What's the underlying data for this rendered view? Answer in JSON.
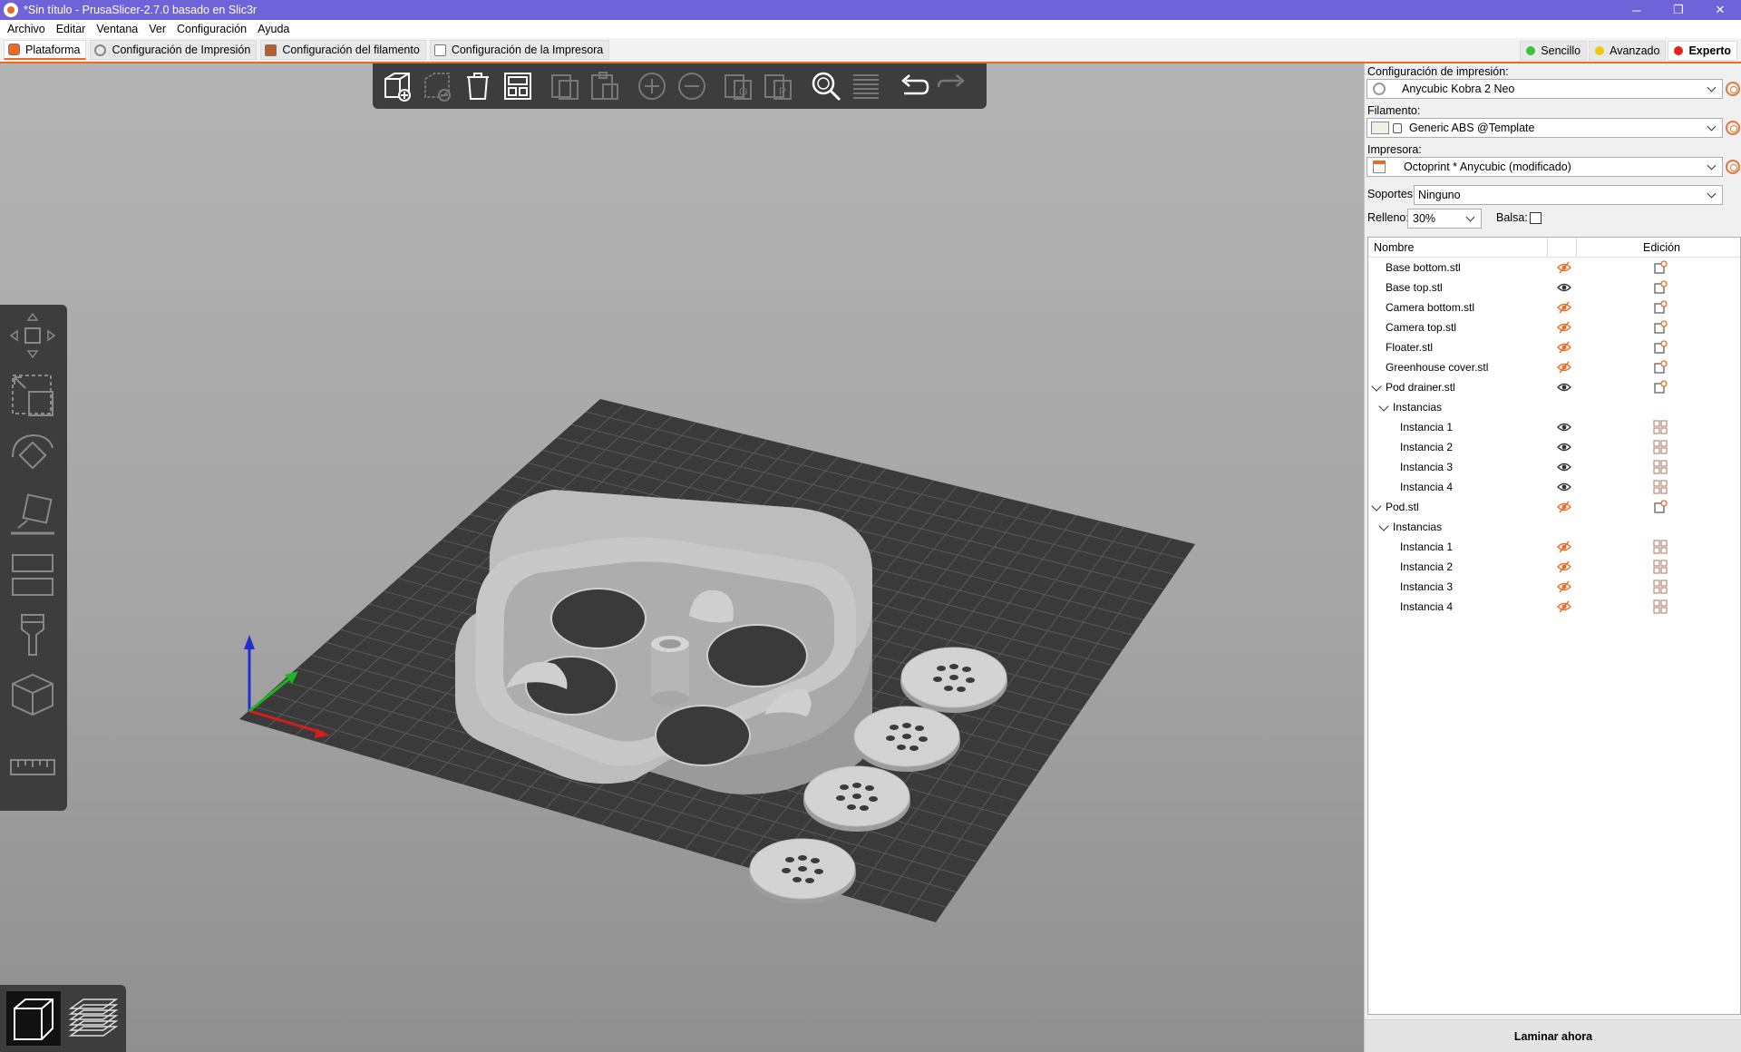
{
  "window": {
    "title": "*Sin título - PrusaSlicer-2.7.0 basado en Slic3r",
    "minimize": "─",
    "maximize": "❐",
    "close": "✕"
  },
  "menu": [
    "Archivo",
    "Editar",
    "Ventana",
    "Ver",
    "Configuración",
    "Ayuda"
  ],
  "tabs": [
    {
      "label": "Plataforma",
      "icon": "plater-icon",
      "active": true
    },
    {
      "label": "Configuración de Impresión",
      "icon": "print-settings-icon",
      "active": false
    },
    {
      "label": "Configuración del filamento",
      "icon": "filament-spool-icon",
      "active": false
    },
    {
      "label": "Configuración de la Impresora",
      "icon": "printer-icon",
      "active": false
    }
  ],
  "modes": [
    {
      "label": "Sencillo",
      "color": "#3cc03c",
      "active": false
    },
    {
      "label": "Avanzado",
      "color": "#f0c814",
      "active": false
    },
    {
      "label": "Experto",
      "color": "#e02222",
      "active": true
    }
  ],
  "sidebar": {
    "print_label": "Configuración de impresión:",
    "print_value": "Anycubic Kobra 2 Neo",
    "filament_label": "Filamento:",
    "filament_value": "Generic ABS @Template",
    "printer_label": "Impresora:",
    "printer_value": "Octoprint * Anycubic (modificado)",
    "supports_label": "Soportes:",
    "supports_value": "Ninguno",
    "infill_label": "Relleno:",
    "infill_value": "30%",
    "brim_label": "Balsa:",
    "brim_checked": false,
    "col_name": "Nombre",
    "col_edit": "Edición",
    "slice_button": "Laminar ahora"
  },
  "objects": [
    {
      "label": "Base bottom.stl",
      "level": 0,
      "visible": false,
      "expanded": null,
      "edit": "object-edit-icon"
    },
    {
      "label": "Base top.stl",
      "level": 0,
      "visible": true,
      "expanded": null,
      "edit": "object-edit-icon"
    },
    {
      "label": "Camera bottom.stl",
      "level": 0,
      "visible": false,
      "expanded": null,
      "edit": "object-edit-icon"
    },
    {
      "label": "Camera top.stl",
      "level": 0,
      "visible": false,
      "expanded": null,
      "edit": "object-edit-icon"
    },
    {
      "label": "Floater.stl",
      "level": 0,
      "visible": false,
      "expanded": null,
      "edit": "object-edit-icon"
    },
    {
      "label": "Greenhouse cover.stl",
      "level": 0,
      "visible": false,
      "expanded": null,
      "edit": "object-edit-icon"
    },
    {
      "label": "Pod drainer.stl",
      "level": 0,
      "visible": true,
      "expanded": true,
      "edit": "object-edit-icon"
    },
    {
      "label": "Instancias",
      "level": 1,
      "visible": null,
      "expanded": true,
      "edit": null
    },
    {
      "label": "Instancia 1",
      "level": 2,
      "visible": true,
      "expanded": null,
      "edit": "instance-icon"
    },
    {
      "label": "Instancia 2",
      "level": 2,
      "visible": true,
      "expanded": null,
      "edit": "instance-icon"
    },
    {
      "label": "Instancia 3",
      "level": 2,
      "visible": true,
      "expanded": null,
      "edit": "instance-icon"
    },
    {
      "label": "Instancia 4",
      "level": 2,
      "visible": true,
      "expanded": null,
      "edit": "instance-icon"
    },
    {
      "label": "Pod.stl",
      "level": 0,
      "visible": false,
      "expanded": true,
      "edit": "object-edit-icon"
    },
    {
      "label": "Instancias",
      "level": 1,
      "visible": null,
      "expanded": true,
      "edit": null
    },
    {
      "label": "Instancia 1",
      "level": 2,
      "visible": false,
      "expanded": null,
      "edit": "instance-icon"
    },
    {
      "label": "Instancia 2",
      "level": 2,
      "visible": false,
      "expanded": null,
      "edit": "instance-icon"
    },
    {
      "label": "Instancia 3",
      "level": 2,
      "visible": false,
      "expanded": null,
      "edit": "instance-icon"
    },
    {
      "label": "Instancia 4",
      "level": 2,
      "visible": false,
      "expanded": null,
      "edit": "instance-icon"
    }
  ],
  "toolbar": {
    "top": [
      "add-object-icon",
      "delete-icon",
      "delete-all-icon",
      "arrange-icon",
      "copy-icon",
      "paste-icon",
      "add-instance-icon",
      "remove-instance-icon",
      "split-objects-icon",
      "split-parts-icon",
      "search-icon",
      "layers-editing-icon",
      "undo-icon",
      "redo-icon"
    ],
    "left": [
      "move-icon",
      "scale-icon",
      "rotate-icon",
      "place-on-face-icon",
      "cut-icon",
      "paint-supports-icon",
      "hollow-icon",
      "measure-icon"
    ],
    "view": [
      "3d-view-icon",
      "preview-layers-icon"
    ]
  },
  "colors": {
    "accent": "#ed6b21",
    "title_bar": "#6f63d9",
    "bed": "#3a3a3a",
    "model": "#b9b9b9"
  }
}
